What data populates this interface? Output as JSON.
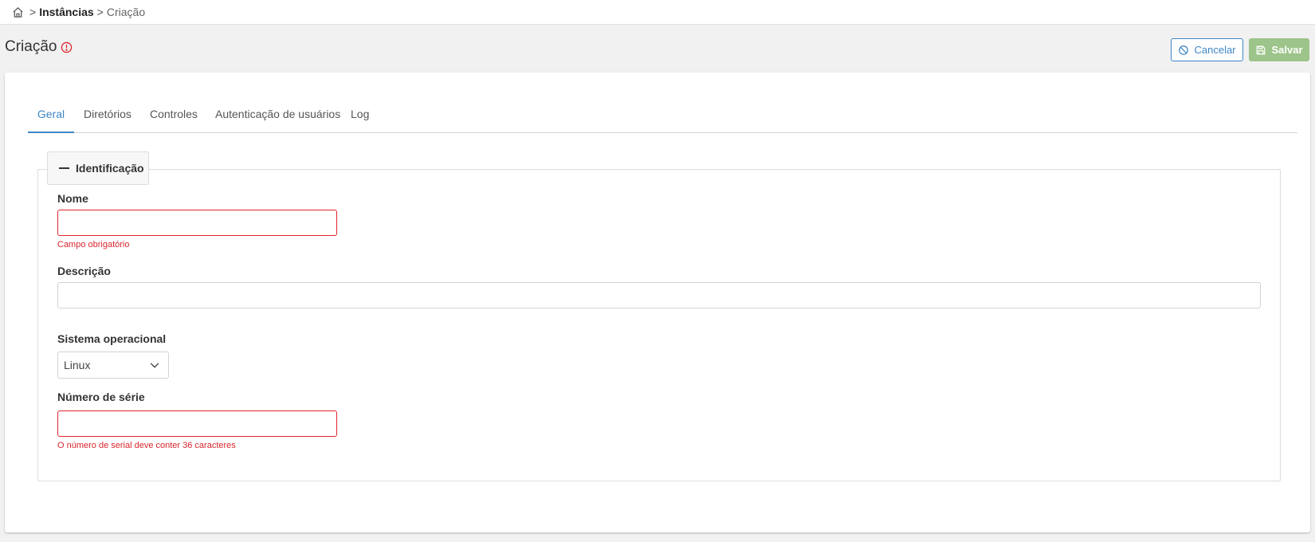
{
  "breadcrumb": {
    "home_icon": "home-icon",
    "separator": ">",
    "level1": "Instâncias",
    "level2": "Criação"
  },
  "page": {
    "title": "Criação",
    "warning_icon": "alert-circle-icon"
  },
  "actions": {
    "cancel_label": "Cancelar",
    "save_label": "Salvar"
  },
  "tabs": [
    {
      "label": "Geral",
      "active": true
    },
    {
      "label": "Diretórios"
    },
    {
      "label": "Controles"
    },
    {
      "label": "Autenticação de usuários"
    },
    {
      "label": "Log"
    }
  ],
  "section": {
    "title": "Identificação"
  },
  "form": {
    "name": {
      "label": "Nome",
      "value": "",
      "error": "Campo obrigatório"
    },
    "description": {
      "label": "Descrição",
      "value": ""
    },
    "os": {
      "label": "Sistema operacional",
      "value": "Linux"
    },
    "serial": {
      "label": "Número de série",
      "value": "",
      "error": "O número de serial deve conter 36 caracteres"
    }
  },
  "colors": {
    "accent": "#3f86c7",
    "save_button": "#9dc48a",
    "error": "#e0242b"
  }
}
